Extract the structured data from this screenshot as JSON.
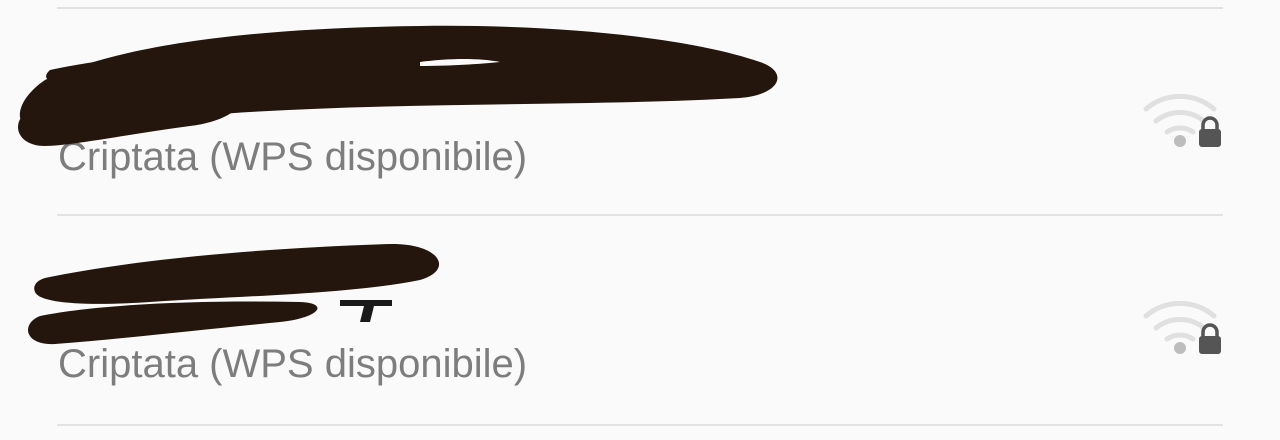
{
  "networks": [
    {
      "name": "",
      "status": "Criptata (WPS disponibile)",
      "icon": "wifi-lock-icon"
    },
    {
      "name": "",
      "status": "Criptata (WPS disponibile)",
      "icon": "wifi-lock-icon"
    }
  ],
  "colors": {
    "background": "#fafafa",
    "divider": "#e2e2e2",
    "status_text": "#7d7d7d",
    "icon_arcs": "#e0e0e0",
    "icon_lock": "#555555",
    "redaction": "#24160c"
  }
}
